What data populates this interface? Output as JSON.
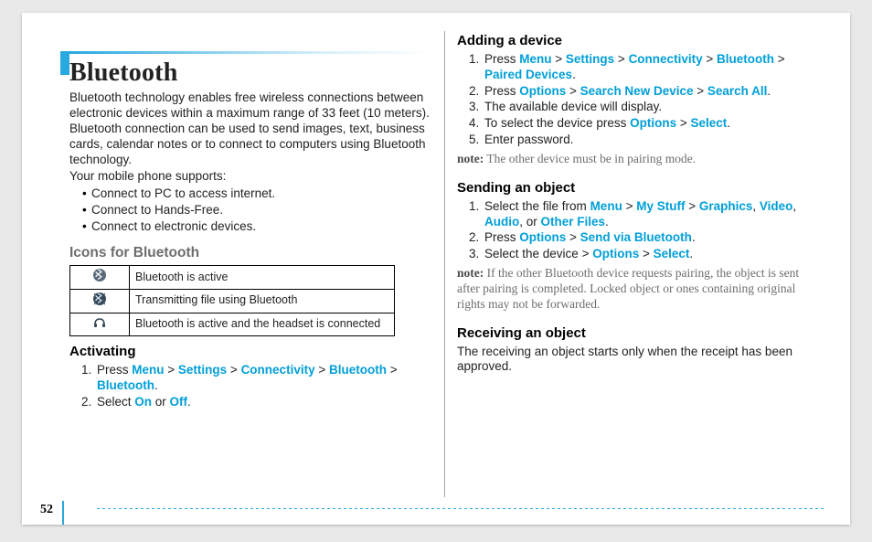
{
  "page_number": "52",
  "left": {
    "title": "Bluetooth",
    "intro": "Bluetooth technology enables free wireless connections between electronic devices within a maximum range of 33 feet (10 meters). Bluetooth connection can be used to send images, text, business cards, calendar notes or to connect to computers using Bluetooth technology.",
    "supports_lead": "Your mobile phone supports:",
    "supports": [
      "Connect to PC to access internet.",
      "Connect to Hands-Free.",
      "Connect to electronic devices."
    ],
    "icons_heading": "Icons for Bluetooth",
    "icons_rows": [
      {
        "icon": "bt-active",
        "desc": "Bluetooth is active"
      },
      {
        "icon": "bt-transmit",
        "desc": "Transmitting file using Bluetooth"
      },
      {
        "icon": "bt-headset",
        "desc": "Bluetooth is active and the headset is connected"
      }
    ],
    "activating_heading": "Activating",
    "activating_steps": [
      {
        "type": "path",
        "prefix": "Press ",
        "items": [
          "Menu",
          "Settings",
          "Connectivity",
          "Bluetooth",
          "Bluetooth"
        ],
        "suffix": "."
      },
      {
        "type": "select",
        "prefix": "Select ",
        "a": "On",
        "mid": " or ",
        "b": "Off",
        "suffix": "."
      }
    ]
  },
  "right": {
    "adding_heading": "Adding a device",
    "adding_steps": [
      {
        "type": "path",
        "prefix": "Press ",
        "items": [
          "Menu",
          "Settings",
          "Connectivity",
          "Bluetooth",
          "Paired Devices"
        ],
        "suffix": "."
      },
      {
        "type": "path",
        "prefix": "Press ",
        "items": [
          "Options",
          "Search New Device",
          "Search All"
        ],
        "suffix": "."
      },
      {
        "type": "plain",
        "text": "The available device will display."
      },
      {
        "type": "path",
        "prefix": "To select the device press ",
        "items": [
          "Options",
          "Select"
        ],
        "suffix": "."
      },
      {
        "type": "plain",
        "text": "Enter password."
      }
    ],
    "adding_note_label": "note:",
    "adding_note_text": " The other device must be in pairing mode.",
    "sending_heading": "Sending an object",
    "sending_steps": [
      {
        "type": "filefrom",
        "prefix": "Select the file from ",
        "path": [
          "Menu",
          "My Stuff"
        ],
        "alts": [
          "Graphics",
          "Video",
          "Audio",
          "Other Files"
        ],
        "suffix": "."
      },
      {
        "type": "path",
        "prefix": "Press ",
        "items": [
          "Options",
          "Send via Bluetooth"
        ],
        "suffix": "."
      },
      {
        "type": "path",
        "prefix": "Select the device > ",
        "items": [
          "Options",
          "Select"
        ],
        "suffix": "."
      }
    ],
    "sending_note_label": "note:",
    "sending_note_text": " If the other Bluetooth device requests pairing, the object is sent after pairing is completed. Locked object or ones containing original rights may not be forwarded.",
    "receiving_heading": "Receiving an object",
    "receiving_text": "The receiving an object starts only when the receipt has been approved."
  },
  "icons": {
    "bt-active": "bt-active",
    "bt-transmit": "bt-transmit",
    "bt-headset": "bt-headset"
  }
}
